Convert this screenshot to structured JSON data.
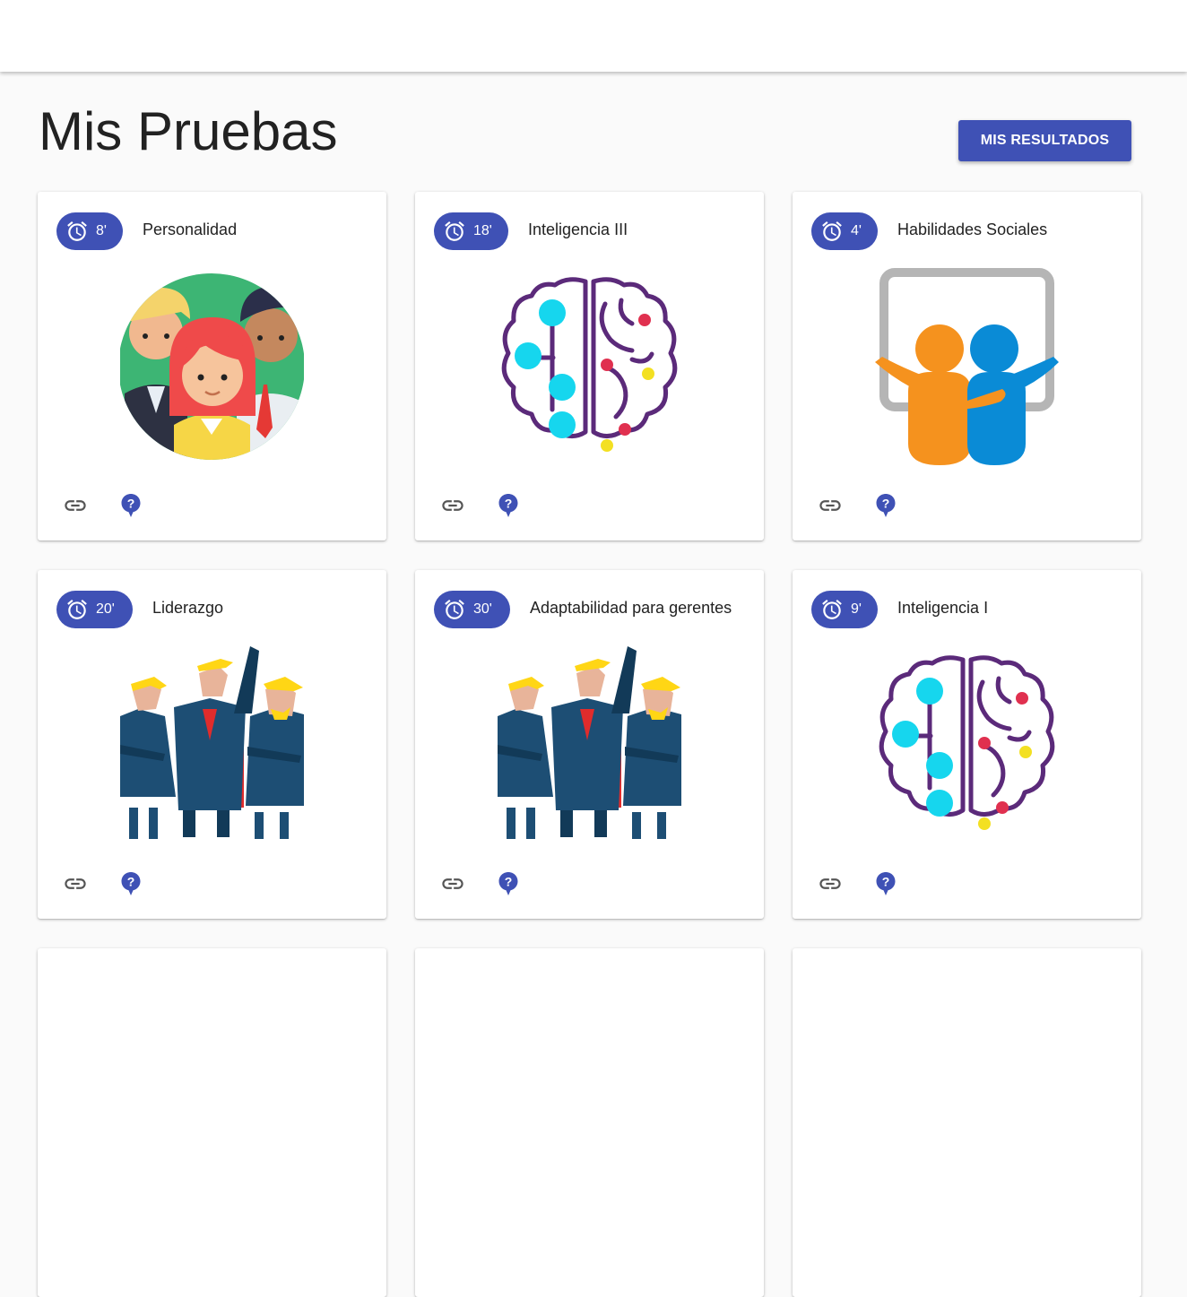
{
  "page": {
    "title": "Mis Pruebas",
    "results_button": "MIS RESULTADOS"
  },
  "colors": {
    "primary": "#3f51b5",
    "brain_outline": "#5b2a7a",
    "brain_node": "#16d6ee"
  },
  "cards": [
    {
      "time": "8'",
      "title": "Personalidad",
      "illustration": "people-group"
    },
    {
      "time": "18'",
      "title": "Inteligencia III",
      "illustration": "brain"
    },
    {
      "time": "4'",
      "title": "Habilidades Sociales",
      "illustration": "board-friends"
    },
    {
      "time": "20'",
      "title": "Liderazgo",
      "illustration": "leaders"
    },
    {
      "time": "30'",
      "title": "Adaptabilidad para gerentes",
      "illustration": "leaders"
    },
    {
      "time": "9'",
      "title": "Inteligencia I",
      "illustration": "brain"
    }
  ],
  "icons": {
    "timer": "alarm-clock-icon",
    "link": "link-icon",
    "help": "help-icon"
  }
}
